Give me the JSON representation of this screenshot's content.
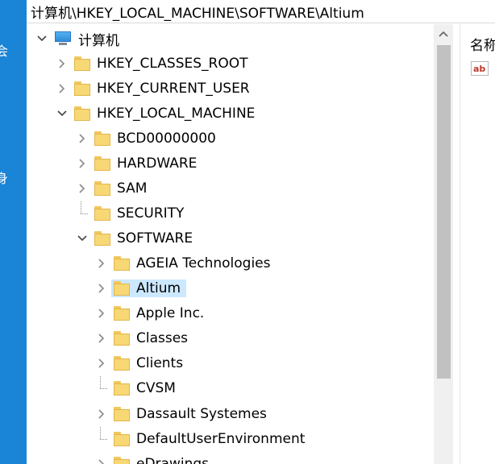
{
  "address_bar": {
    "path": "计算机\\HKEY_LOCAL_MACHINE\\SOFTWARE\\Altium"
  },
  "left_strip": {
    "text_top": "会",
    "text_bottom": "身"
  },
  "tree": {
    "root": "计算机",
    "hives": {
      "classes_root": "HKEY_CLASSES_ROOT",
      "current_user": "HKEY_CURRENT_USER",
      "local_machine": "HKEY_LOCAL_MACHINE"
    },
    "hklm_children": {
      "bcd": "BCD00000000",
      "hardware": "HARDWARE",
      "sam": "SAM",
      "security": "SECURITY",
      "software": "SOFTWARE"
    },
    "software_children": [
      "AGEIA Technologies",
      "Altium",
      "Apple Inc.",
      "Classes",
      "Clients",
      "CVSM",
      "Dassault Systemes",
      "DefaultUserEnvironment",
      "eDrawings"
    ],
    "selected": "Altium"
  },
  "right_pane": {
    "column_header": "名称",
    "value_icon": "ab"
  }
}
